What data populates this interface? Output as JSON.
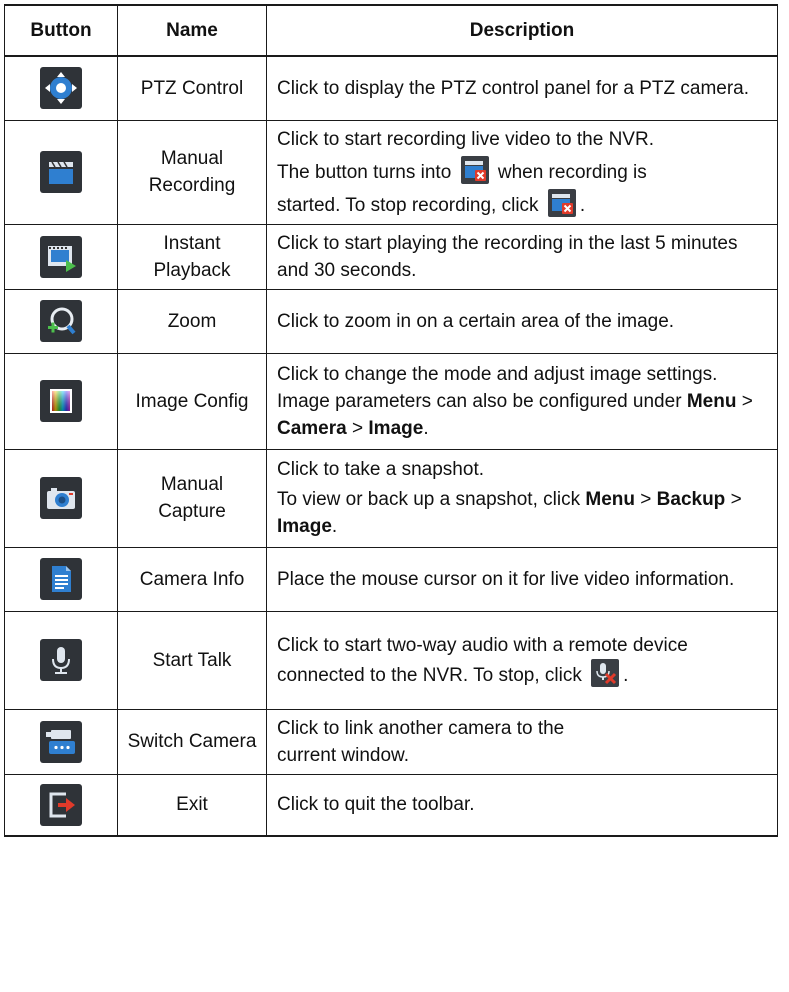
{
  "headers": {
    "button": "Button",
    "name": "Name",
    "description": "Description"
  },
  "rows": [
    {
      "name": "PTZ Control",
      "icon": "ptz-control-icon",
      "desc": [
        "Click to display the PTZ control panel for a PTZ camera."
      ]
    },
    {
      "name": "Manual Recording",
      "icon": "clapperboard-icon",
      "desc_a": "Click to start recording live video to the NVR.",
      "desc_b1": "The button turns into",
      "desc_b2": "when recording is",
      "desc_c1": "started. To stop recording, click",
      "desc_c2": "."
    },
    {
      "name": "Instant Playback",
      "icon": "instant-playback-icon",
      "desc": [
        "Click to start playing the recording in the last 5 minutes and 30 seconds."
      ]
    },
    {
      "name": "Zoom",
      "icon": "zoom-icon",
      "desc": [
        "Click to zoom in on a certain area of the image."
      ]
    },
    {
      "name": "Image Config",
      "icon": "color-spectrum-icon",
      "desc_a": "Click to change the mode and adjust image settings. Image parameters can also be configured under",
      "menu": "Menu",
      "sep": ">",
      "camera": "Camera",
      "image": "Image",
      "end": "."
    },
    {
      "name": "Manual Capture",
      "icon": "camera-icon",
      "desc_a": "Click to take a snapshot.",
      "desc_b": "To view or back up a snapshot, click",
      "menu": "Menu",
      "sep": ">",
      "backup": "Backup",
      "image": "Image",
      "end": "."
    },
    {
      "name": "Camera Info",
      "icon": "document-icon",
      "desc": [
        "Place the mouse cursor on it for live video information."
      ]
    },
    {
      "name": "Start Talk",
      "icon": "microphone-icon",
      "desc_a": "Click to start two-way audio with a remote device connected to the NVR. To stop, click",
      "end": "."
    },
    {
      "name": "Switch Camera",
      "icon": "switch-camera-icon",
      "desc": [
        "Click to link another camera to the",
        "current window."
      ]
    },
    {
      "name": "Exit",
      "icon": "exit-icon",
      "desc": [
        "Click to quit the toolbar."
      ]
    }
  ],
  "colors": {
    "icon_bg": "#2f3338",
    "accent_blue": "#2f7fd0",
    "accent_red": "#e03a2a",
    "accent_green": "#4cbf4c"
  }
}
